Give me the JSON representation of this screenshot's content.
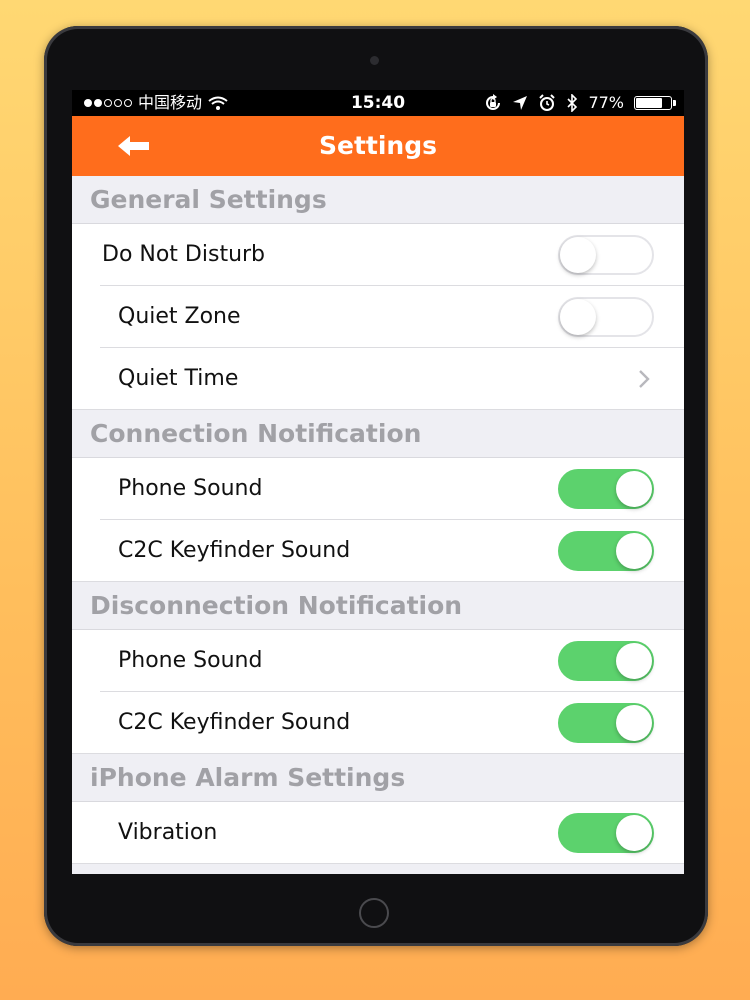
{
  "status_bar": {
    "carrier": "中国移动",
    "time": "15:40",
    "battery": "77%",
    "battery_level": 0.77,
    "signal": [
      true,
      true,
      false,
      false,
      false
    ]
  },
  "nav": {
    "title": "Settings"
  },
  "sections": [
    {
      "header": "General Settings",
      "rows": [
        {
          "label": "Do Not Disturb",
          "control": "toggle",
          "on": false,
          "level": 0
        },
        {
          "label": "Quiet Zone",
          "control": "toggle",
          "on": false,
          "level": 1
        },
        {
          "label": "Quiet Time",
          "control": "chevron",
          "level": 1
        }
      ]
    },
    {
      "header": "Connection Notification",
      "rows": [
        {
          "label": "Phone Sound",
          "control": "toggle",
          "on": true,
          "level": 1
        },
        {
          "label": "C2C Keyfinder Sound",
          "control": "toggle",
          "on": true,
          "level": 1
        }
      ]
    },
    {
      "header": "Disconnection Notification",
      "rows": [
        {
          "label": "Phone Sound",
          "control": "toggle",
          "on": true,
          "level": 1
        },
        {
          "label": "C2C Keyfinder Sound",
          "control": "toggle",
          "on": true,
          "level": 1
        }
      ]
    },
    {
      "header": "iPhone Alarm Settings",
      "rows": [
        {
          "label": "Vibration",
          "control": "toggle",
          "on": true,
          "level": 1
        }
      ]
    }
  ],
  "colors": {
    "nav_bar": "#ff6d1c",
    "toggle_on": "#5cd26d",
    "section_header_text": "#a1a1a6",
    "background": "#ffc45e"
  }
}
